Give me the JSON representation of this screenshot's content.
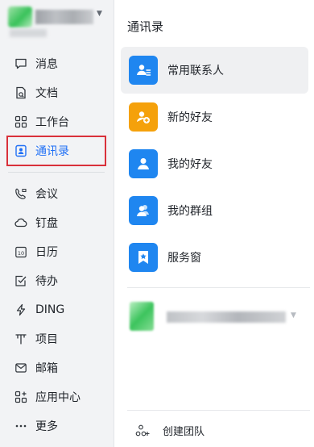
{
  "sidebar": {
    "account_caret_icon": "caret-down-icon",
    "items": [
      {
        "label": "消息",
        "icon": "message-icon"
      },
      {
        "label": "文档",
        "icon": "document-icon"
      },
      {
        "label": "工作台",
        "icon": "workbench-icon"
      },
      {
        "label": "通讯录",
        "icon": "contacts-icon",
        "active": true
      },
      {
        "label": "会议",
        "icon": "meeting-icon"
      },
      {
        "label": "钉盘",
        "icon": "cloud-drive-icon"
      },
      {
        "label": "日历",
        "icon": "calendar-icon",
        "icon_text": "10"
      },
      {
        "label": "待办",
        "icon": "todo-icon"
      },
      {
        "label": "DING",
        "icon": "ding-icon"
      },
      {
        "label": "项目",
        "icon": "project-icon"
      },
      {
        "label": "邮箱",
        "icon": "mail-icon"
      },
      {
        "label": "应用中心",
        "icon": "app-center-icon"
      },
      {
        "label": "更多",
        "icon": "more-icon"
      }
    ]
  },
  "main": {
    "title": "通讯录",
    "contacts": [
      {
        "label": "常用联系人",
        "icon": "frequent-contacts-icon",
        "color": "#1f86f0",
        "selected": true
      },
      {
        "label": "新的好友",
        "icon": "new-friend-icon",
        "color": "#f5a10b"
      },
      {
        "label": "我的好友",
        "icon": "my-friends-icon",
        "color": "#1f86f0"
      },
      {
        "label": "我的群组",
        "icon": "my-groups-icon",
        "color": "#1f86f0"
      },
      {
        "label": "服务窗",
        "icon": "service-window-icon",
        "color": "#1f86f0"
      }
    ],
    "create_team_label": "创建团队",
    "create_team_icon": "create-team-icon"
  },
  "colors": {
    "accent": "#1f6ff5",
    "sidebar_bg": "#f2f3f5",
    "highlight_border": "#d9303a"
  }
}
